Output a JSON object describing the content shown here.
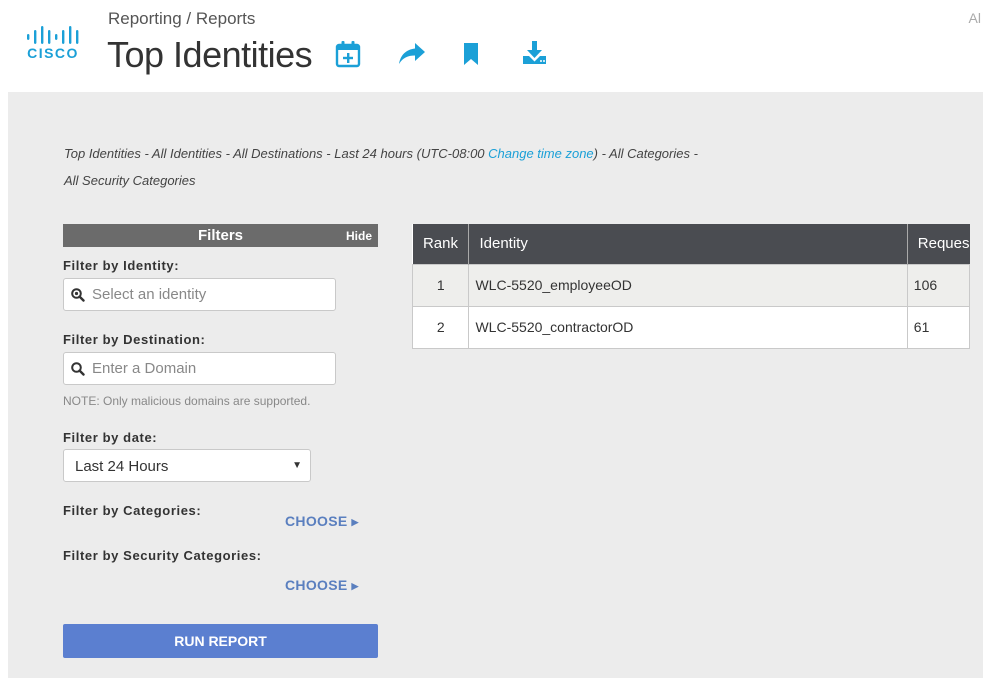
{
  "app": {
    "logo_text": "CISCO",
    "breadcrumb": "Reporting / Reports",
    "title": "Top Identities",
    "top_right_text": "Al"
  },
  "toolbar": {
    "icons": [
      "calendar-add-icon",
      "share-icon",
      "bookmark-icon",
      "download-icon"
    ],
    "accent_color": "#1ba0d7"
  },
  "summary": {
    "part1": "Top Identities - All Identities - All Destinations - Last 24 hours (UTC-08:00 ",
    "link": "Change time zone",
    "part2": ") - All Categories -",
    "line2": "All Security Categories"
  },
  "filters": {
    "title": "Filters",
    "hide_label": "Hide",
    "identity_label": "Filter by Identity:",
    "identity_placeholder": "Select an identity",
    "destination_label": "Filter by Destination:",
    "destination_placeholder": "Enter a Domain",
    "destination_note": "NOTE: Only malicious domains are supported.",
    "date_label": "Filter by date:",
    "date_value": "Last 24 Hours",
    "categories_label": "Filter by Categories:",
    "categories_choose": "CHOOSE",
    "security_label": "Filter by Security Categories:",
    "security_choose": "CHOOSE",
    "run_button": "RUN REPORT"
  },
  "table": {
    "headers": [
      "Rank",
      "Identity",
      "Reques"
    ],
    "rows": [
      {
        "rank": "1",
        "identity": "WLC-5520_employeeOD",
        "requests": "106"
      },
      {
        "rank": "2",
        "identity": "WLC-5520_contractorOD",
        "requests": "61"
      }
    ]
  }
}
